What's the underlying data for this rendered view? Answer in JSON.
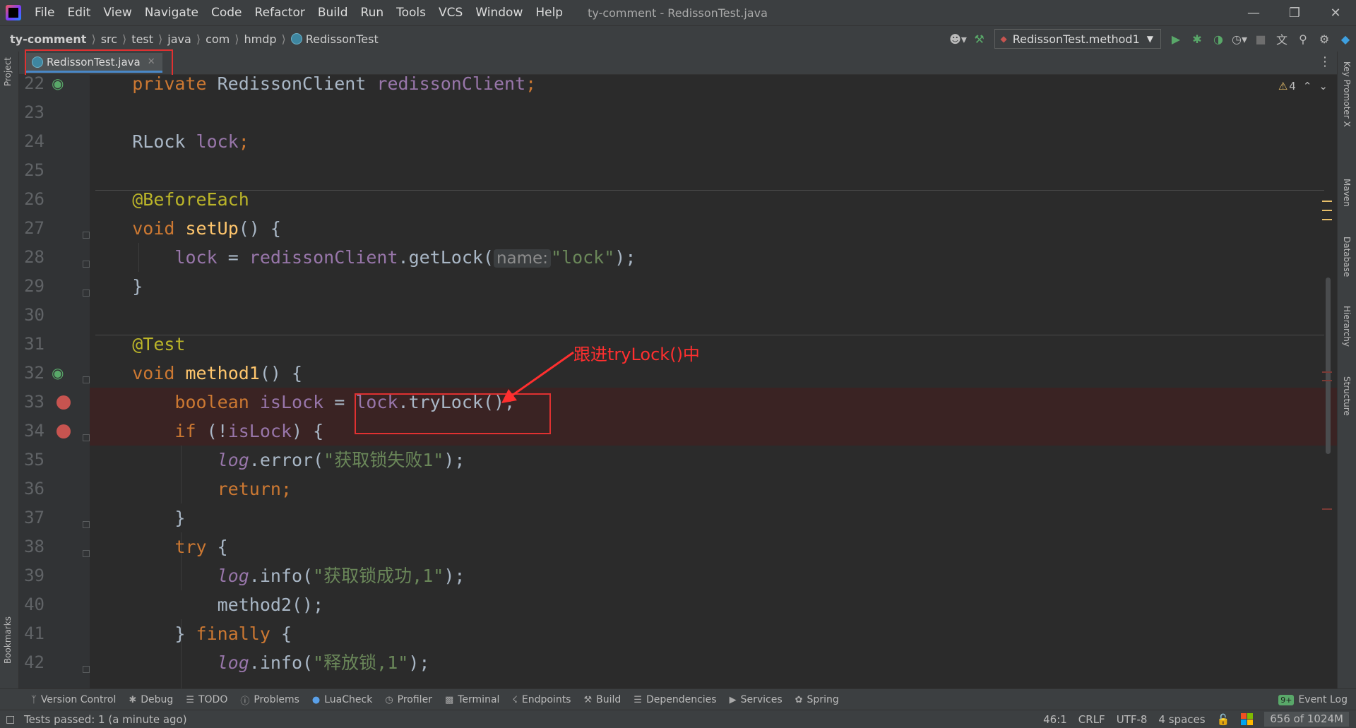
{
  "menu": [
    "File",
    "Edit",
    "View",
    "Navigate",
    "Code",
    "Refactor",
    "Build",
    "Run",
    "Tools",
    "VCS",
    "Window",
    "Help"
  ],
  "window_title": "ty-comment - RedissonTest.java",
  "breadcrumbs": [
    "ty-comment",
    "src",
    "test",
    "java",
    "com",
    "hmdp",
    "RedissonTest"
  ],
  "run_config": "RedissonTest.method1",
  "tab": {
    "label": "RedissonTest.java"
  },
  "left_tools": [
    "Project",
    "Bookmarks"
  ],
  "right_tools": [
    "Key Promoter X",
    "Maven",
    "Database",
    "Hierarchy",
    "Structure"
  ],
  "editor": {
    "warnings": "4",
    "line_numbers": [
      "22",
      "23",
      "24",
      "25",
      "26",
      "27",
      "28",
      "29",
      "30",
      "31",
      "32",
      "33",
      "34",
      "35",
      "36",
      "37",
      "38",
      "39",
      "40",
      "41",
      "42"
    ],
    "code": {
      "l22": [
        "private",
        " RedissonClient ",
        "redissonClient",
        ";"
      ],
      "l24": [
        "RLock ",
        "lock",
        ";"
      ],
      "l26": [
        "@BeforeEach"
      ],
      "l27": [
        "void ",
        "setUp",
        "() {"
      ],
      "l28": [
        "lock",
        " = ",
        "redissonClient",
        ".getLock(",
        "name:",
        "\"lock\"",
        ");"
      ],
      "l29": [
        "}"
      ],
      "l31": [
        "@Test"
      ],
      "l32": [
        "void ",
        "method1",
        "() {"
      ],
      "l33": [
        "boolean ",
        "isLock",
        " = ",
        "lock",
        ".tryLock();"
      ],
      "l34": [
        "if",
        " (!",
        "isLock",
        ") {"
      ],
      "l35": [
        "log",
        ".error(",
        "\"获取锁失败1\"",
        ");"
      ],
      "l36": [
        "return;"
      ],
      "l37": [
        "}"
      ],
      "l38": [
        "try",
        " {"
      ],
      "l39": [
        "log",
        ".info(",
        "\"获取锁成功,1\"",
        ");"
      ],
      "l40": [
        "method2();"
      ],
      "l41": [
        "}",
        " finally",
        " {"
      ],
      "l42": [
        "log",
        ".info(",
        "\"释放锁,1\"",
        ");"
      ]
    }
  },
  "annotation": "跟进tryLock()中",
  "bottom_tools": [
    "Version Control",
    "Debug",
    "TODO",
    "Problems",
    "LuaCheck",
    "Profiler",
    "Terminal",
    "Endpoints",
    "Build",
    "Dependencies",
    "Services",
    "Spring"
  ],
  "event_log": {
    "badge": "9+",
    "label": "Event Log"
  },
  "status": {
    "message": "Tests passed: 1 (a minute ago)",
    "position": "46:1",
    "line_sep": "CRLF",
    "encoding": "UTF-8",
    "indent": "4 spaces",
    "memory": "656 of 1024M"
  },
  "colors": {
    "keyword": "#cc7832",
    "field": "#9876aa",
    "annotation": "#bbb529",
    "method": "#ffc66d",
    "string": "#6a8759",
    "highlight": "#e03131"
  }
}
